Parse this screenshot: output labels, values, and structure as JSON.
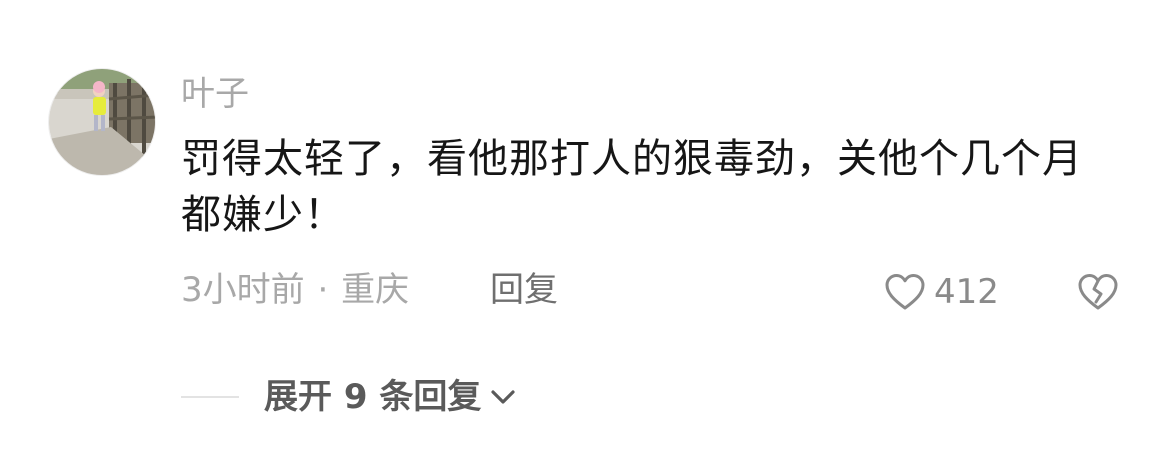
{
  "comment": {
    "username": "叶子",
    "text": "罚得太轻了，看他那打人的狠毒劲，关他个几个月都嫌少！",
    "time": "3小时前",
    "separator": "·",
    "location": "重庆",
    "reply_label": "回复",
    "like_count": "412",
    "expand_label": "展开 9 条回复"
  },
  "icons": {
    "like": "heart-outline-icon",
    "dislike": "broken-heart-outline-icon",
    "expand": "chevron-down-icon"
  },
  "colors": {
    "text": "#161616",
    "secondary": "#a8a8a8",
    "action": "#6f6f6f",
    "expand": "#5a5a5a"
  }
}
